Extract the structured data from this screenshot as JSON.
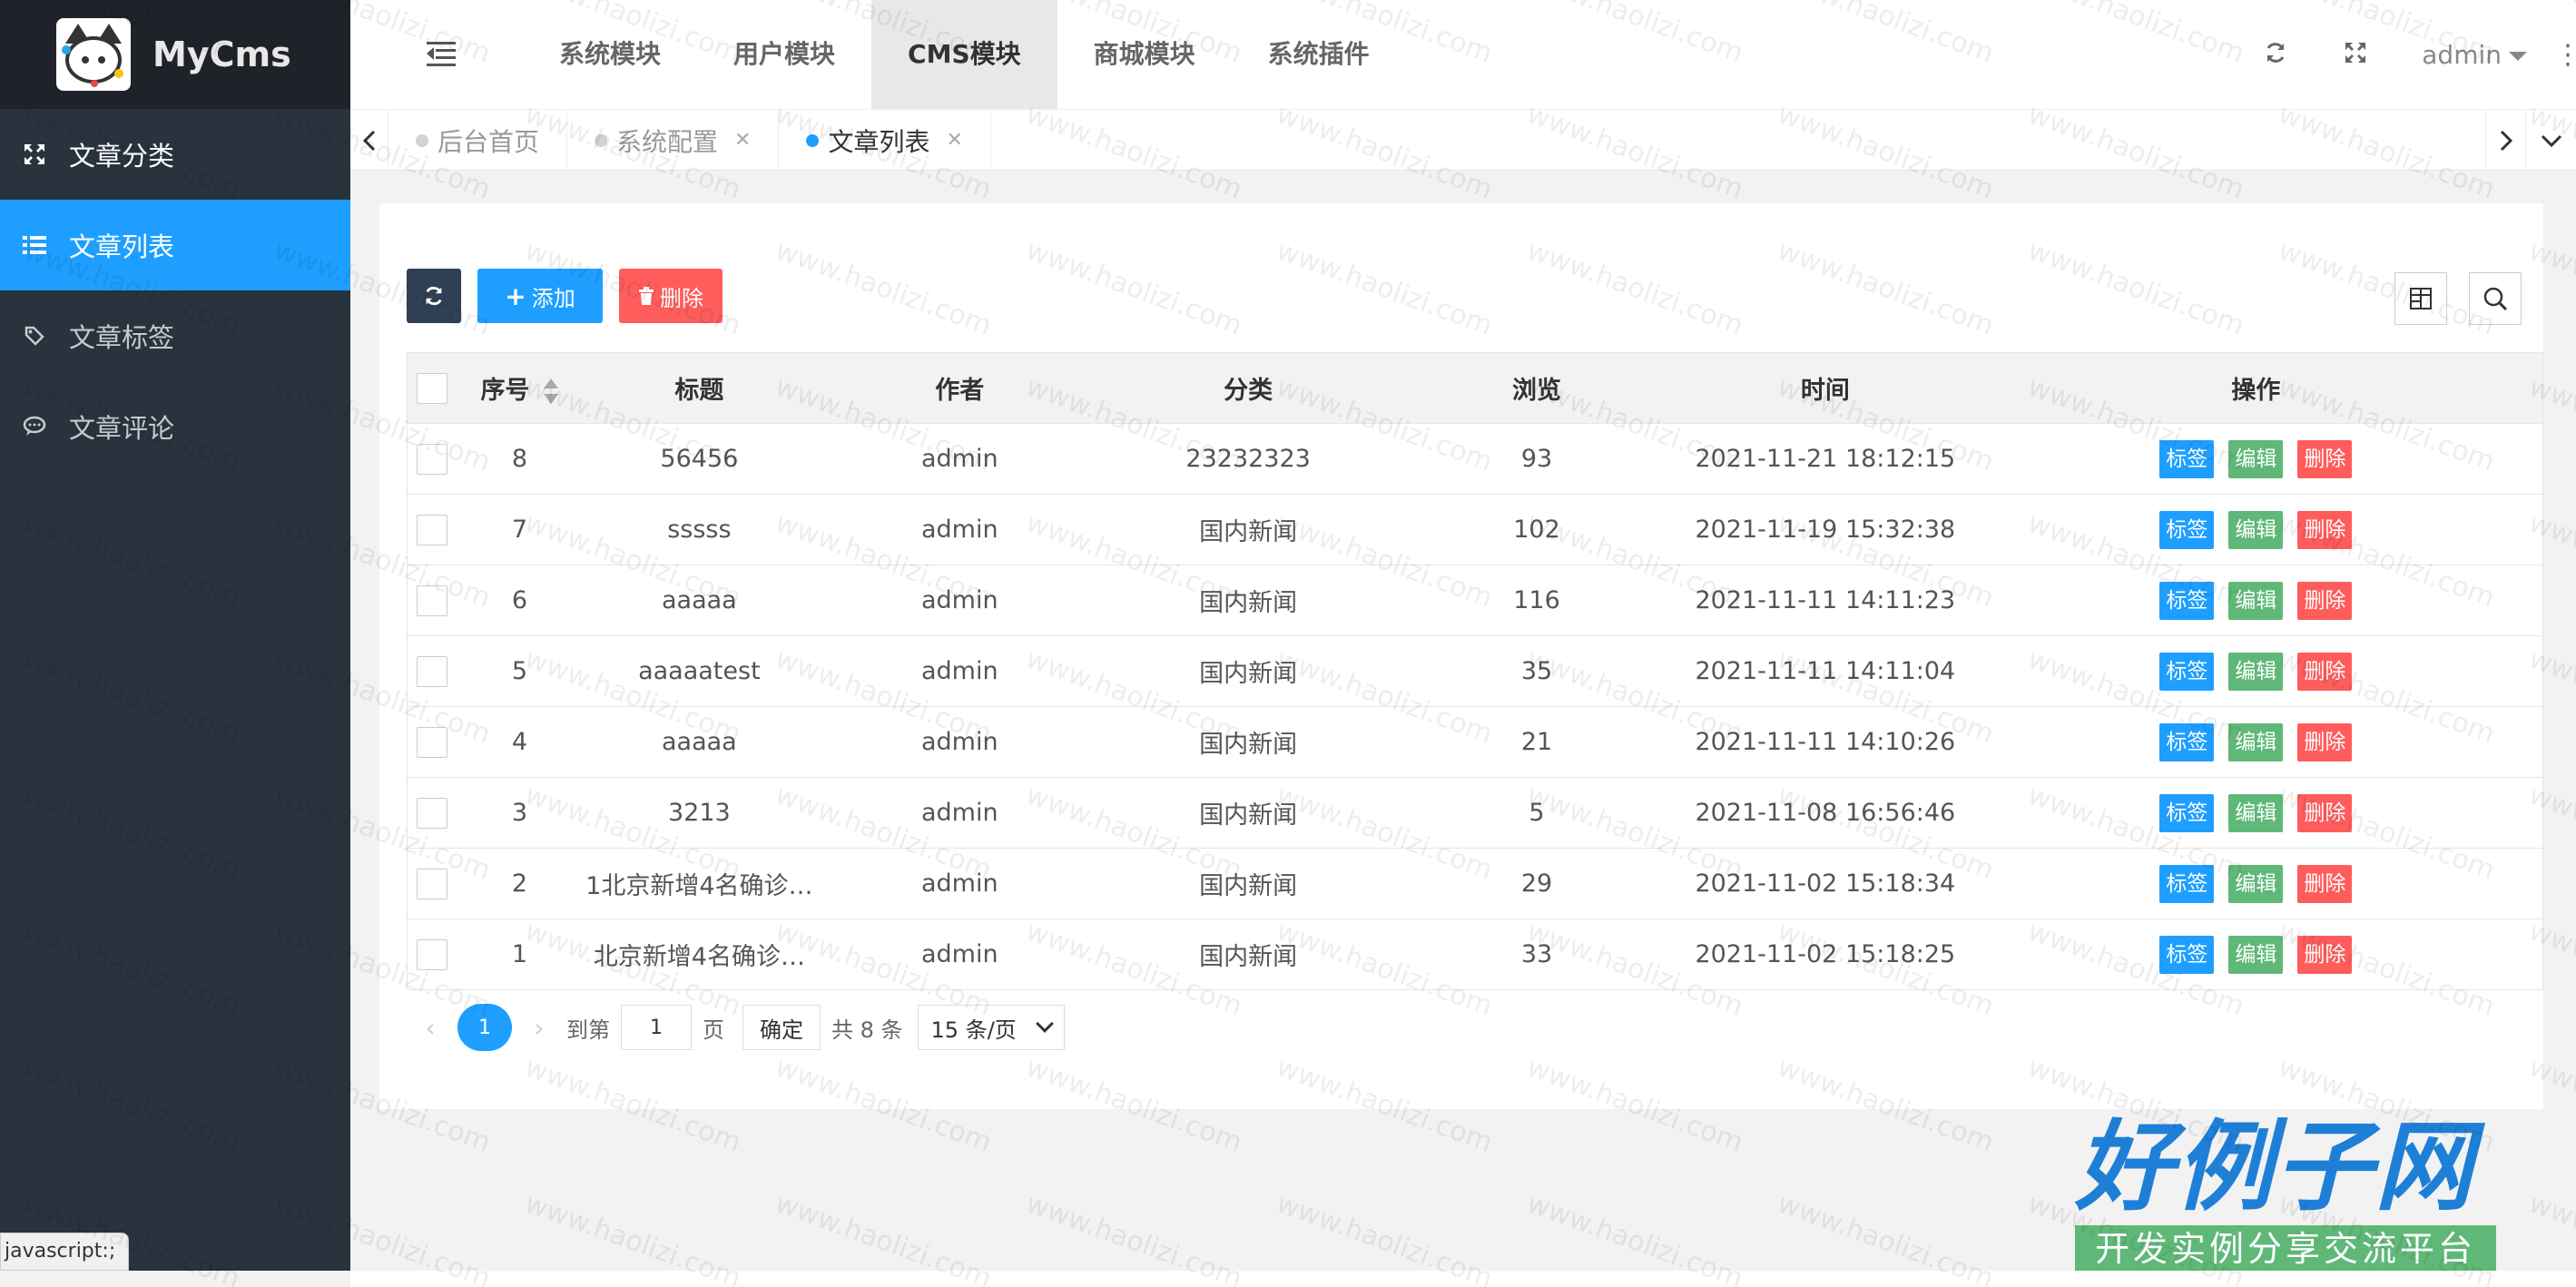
{
  "app": {
    "name": "MyCms"
  },
  "sidebar": {
    "items": [
      {
        "label": "文章分类",
        "icon": "expand-icon"
      },
      {
        "label": "文章列表",
        "icon": "list-icon"
      },
      {
        "label": "文章标签",
        "icon": "tag-icon"
      },
      {
        "label": "文章评论",
        "icon": "comment-icon"
      }
    ]
  },
  "status_tip": "javascript:;",
  "header": {
    "modules": [
      "系统模块",
      "用户模块",
      "CMS模块",
      "商城模块",
      "系统插件"
    ],
    "active_module": "CMS模块",
    "user": "admin",
    "more": "⋮"
  },
  "tabs": [
    {
      "label": "后台首页",
      "closable": false
    },
    {
      "label": "系统配置",
      "closable": true
    },
    {
      "label": "文章列表",
      "closable": true,
      "active": true
    }
  ],
  "toolbar": {
    "add": "添加",
    "delete": "删除"
  },
  "table": {
    "columns": [
      "序号",
      "标题",
      "作者",
      "分类",
      "浏览",
      "时间",
      "操作"
    ],
    "rows": [
      {
        "id": "8",
        "title": "56456",
        "author": "admin",
        "category": "23232323",
        "views": "93",
        "time": "2021-11-21 18:12:15"
      },
      {
        "id": "7",
        "title": "sssss",
        "author": "admin",
        "category": "国内新闻",
        "views": "102",
        "time": "2021-11-19 15:32:38"
      },
      {
        "id": "6",
        "title": "aaaaa",
        "author": "admin",
        "category": "国内新闻",
        "views": "116",
        "time": "2021-11-11 14:11:23"
      },
      {
        "id": "5",
        "title": "aaaaatest",
        "author": "admin",
        "category": "国内新闻",
        "views": "35",
        "time": "2021-11-11 14:11:04"
      },
      {
        "id": "4",
        "title": "aaaaa",
        "author": "admin",
        "category": "国内新闻",
        "views": "21",
        "time": "2021-11-11 14:10:26"
      },
      {
        "id": "3",
        "title": "3213",
        "author": "admin",
        "category": "国内新闻",
        "views": "5",
        "time": "2021-11-08 16:56:46"
      },
      {
        "id": "2",
        "title": "1北京新增4名确诊…",
        "author": "admin",
        "category": "国内新闻",
        "views": "29",
        "time": "2021-11-02 15:18:34"
      },
      {
        "id": "1",
        "title": "北京新增4名确诊…",
        "author": "admin",
        "category": "国内新闻",
        "views": "33",
        "time": "2021-11-02 15:18:25"
      }
    ],
    "ops": {
      "tag": "标签",
      "edit": "编辑",
      "delete": "删除"
    }
  },
  "pager": {
    "current": "1",
    "goto_label": "到第",
    "goto_value": "1",
    "page_unit": "页",
    "confirm": "确定",
    "total": "共 8 条",
    "page_size": "15 条/页"
  },
  "brand": {
    "big": "好例子网",
    "small": "开发实例分享交流平台"
  },
  "watermark_text": "www.haolizi.com",
  "colors": {
    "primary": "#1e9fff",
    "success": "#5fb878",
    "danger": "#ff5c5c",
    "sidebar": "#28333e",
    "dark_button": "#2f4056"
  }
}
